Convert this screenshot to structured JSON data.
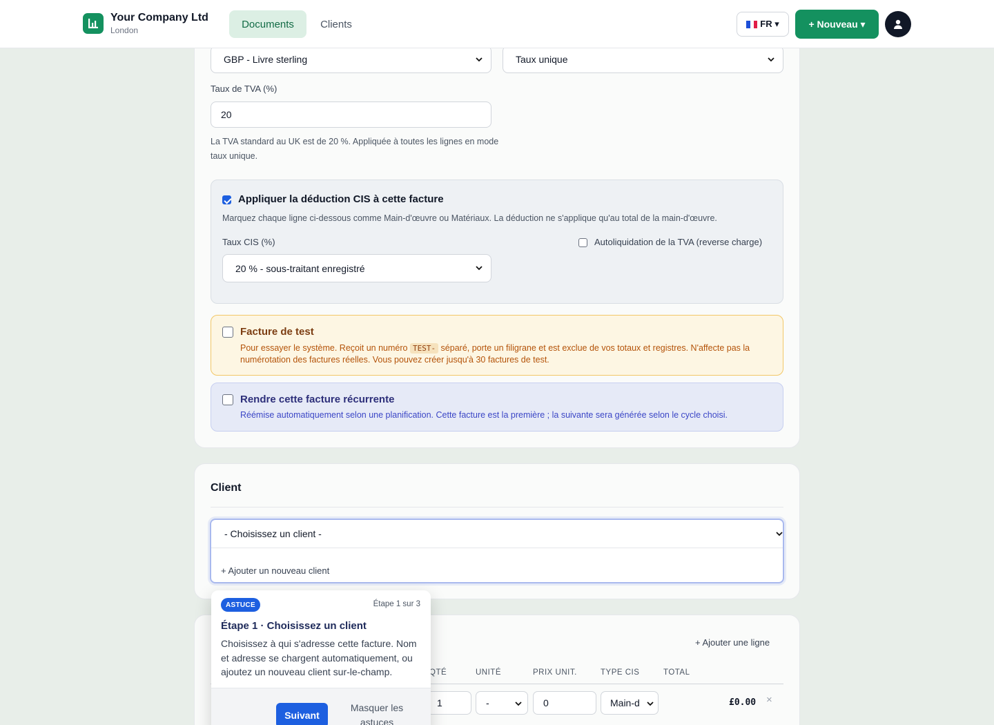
{
  "header": {
    "company_name": "Your Company Ltd",
    "company_city": "London",
    "nav": {
      "documents": "Documents",
      "clients": "Clients"
    },
    "language": "FR ▾",
    "new_button": "+ Nouveau ▾",
    "brand_color": "#14915f"
  },
  "settings": {
    "currency_value": "GBP - Livre sterling",
    "vat_mode_value": "Taux unique",
    "vat_rate_label": "Taux de TVA (%)",
    "vat_rate_value": "20",
    "vat_help": "La TVA standard au UK est de 20 %. Appliquée à toutes les lignes en mode taux unique."
  },
  "cis": {
    "checked": true,
    "title": "Appliquer la déduction CIS à cette facture",
    "description": "Marquez chaque ligne ci-dessous comme Main-d'œuvre ou Matériaux. La déduction ne s'applique qu'au total de la main-d'œuvre.",
    "rate_label": "Taux CIS (%)",
    "rate_value": "20 % - sous-traitant enregistré",
    "reverse_charge_label": "Autoliquidation de la TVA (reverse charge)"
  },
  "test_invoice": {
    "title": "Facture de test",
    "desc_before": "Pour essayer le système. Reçoit un numéro ",
    "code": "TEST-",
    "desc_after": " séparé, porte un filigrane et est exclue de vos totaux et registres. N'affecte pas la numérotation des factures réelles. Vous pouvez créer jusqu'à 30 factures de test."
  },
  "recurring": {
    "title": "Rendre cette facture récurrente",
    "description": "Réémise automatiquement selon une planification. Cette facture est la première ; la suivante sera générée selon le cycle choisi."
  },
  "client": {
    "section_title": "Client",
    "select_placeholder": "- Choisissez un client -",
    "add_new": "+ Ajouter un nouveau client"
  },
  "lines": {
    "add_line": "+ Ajouter une ligne",
    "columns": [
      "QTÉ",
      "UNITÉ",
      "PRIX UNIT.",
      "TYPE CIS",
      "TOTAL"
    ],
    "row": {
      "qty": "1",
      "unit": "-",
      "unit_price": "0",
      "cis_type": "Main-d",
      "total": "£0.00",
      "remove": "×"
    }
  },
  "tip": {
    "badge": "ASTUCE",
    "step": "Étape 1 sur 3",
    "title": "Étape 1 · Choisissez un client",
    "body": "Choisissez à qui s'adresse cette facture. Nom et adresse se chargent automatiquement, ou ajoutez un nouveau client sur-le-champ.",
    "next": "Suivant",
    "hide": "Masquer les astuces"
  }
}
